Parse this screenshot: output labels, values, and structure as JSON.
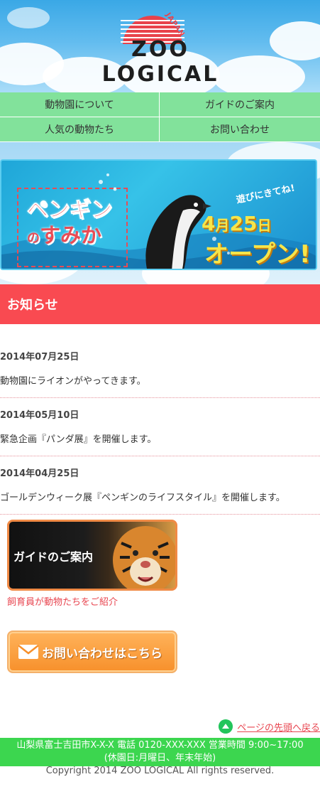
{
  "header": {
    "logo_text": "ZOO LOGICAL",
    "logo_japan": "JAPAN"
  },
  "nav": {
    "items": [
      {
        "label": "動物園について"
      },
      {
        "label": "ガイドのご案内"
      },
      {
        "label": "人気の動物たち"
      },
      {
        "label": "お問い合わせ"
      }
    ]
  },
  "banner": {
    "title_line1": "ペンギン",
    "title_line2_prefix": "の",
    "title_line2_main": "すみか",
    "play_text": "遊びにきてね!",
    "date_num_month": "4",
    "date_month_unit": "月",
    "date_num_day": "25",
    "date_day_unit": "日",
    "open_text": "オープン!"
  },
  "news": {
    "heading": "お知らせ",
    "items": [
      {
        "date": "2014年07月25日",
        "text": "動物園にライオンがやってきます。"
      },
      {
        "date": "2014年05月10日",
        "text": "緊急企画『パンダ展』を開催します。"
      },
      {
        "date": "2014年04月25日",
        "text": "ゴールデンウィーク展『ペンギンのライフスタイル』を開催します。"
      }
    ]
  },
  "guide": {
    "label": "ガイドのご案内",
    "caption": "飼育員が動物たちをご紹介"
  },
  "contact": {
    "label": "お問い合わせはこちら"
  },
  "totop": {
    "label": "ページの先頭へ戻る"
  },
  "footer": {
    "line1": "山梨県富士吉田市X-X-X 電話 0120-XXX-XXX 営業時間 9:00~17:00",
    "line2": "(休園日:月曜日、年末年始)",
    "copyright": "Copyright 2014 ZOO LOGICAL All rights reserved."
  },
  "colors": {
    "accent_red": "#f94a51",
    "nav_green": "#82e29b",
    "footer_green": "#3cd64f",
    "contact_orange": "#f7902b"
  }
}
